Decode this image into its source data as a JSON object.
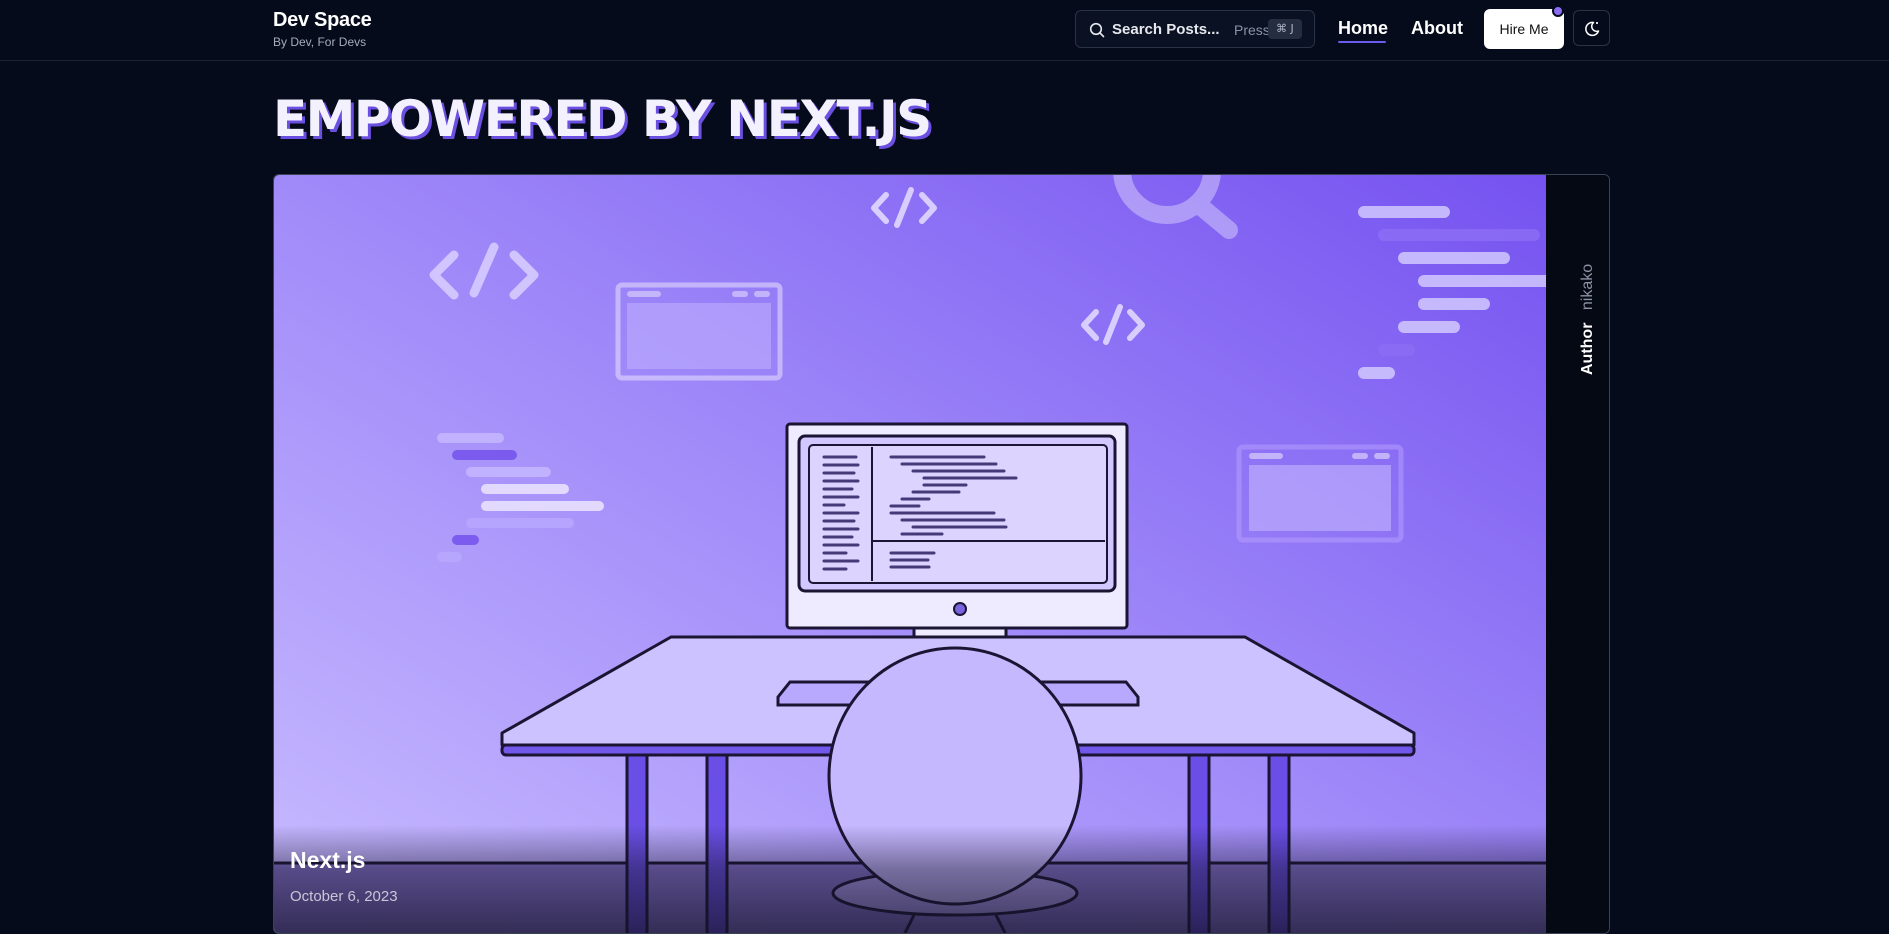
{
  "header": {
    "brand_title": "Dev Space",
    "brand_subtitle": "By Dev, For Devs",
    "search_label": "Search Posts...",
    "search_press": "Press",
    "search_shortcut": "⌘ J",
    "nav": [
      {
        "label": "Home",
        "active": true
      },
      {
        "label": "About",
        "active": false
      }
    ],
    "hire_label": "Hire Me",
    "theme_toggle_icon": "moon-sun-icon"
  },
  "page": {
    "title": "EMPOWERED BY NEXT.JS"
  },
  "featured_post": {
    "title": "Next.js",
    "date": "October 6, 2023",
    "author_label": "Author",
    "author_name": "nikako",
    "image_description_icon": "developer-desk-illustration"
  },
  "colors": {
    "background": "#050b1a",
    "accent": "#6b5cf0",
    "hero_gradient_start": "#c6b8ff",
    "hero_gradient_end": "#7a5cf2"
  }
}
